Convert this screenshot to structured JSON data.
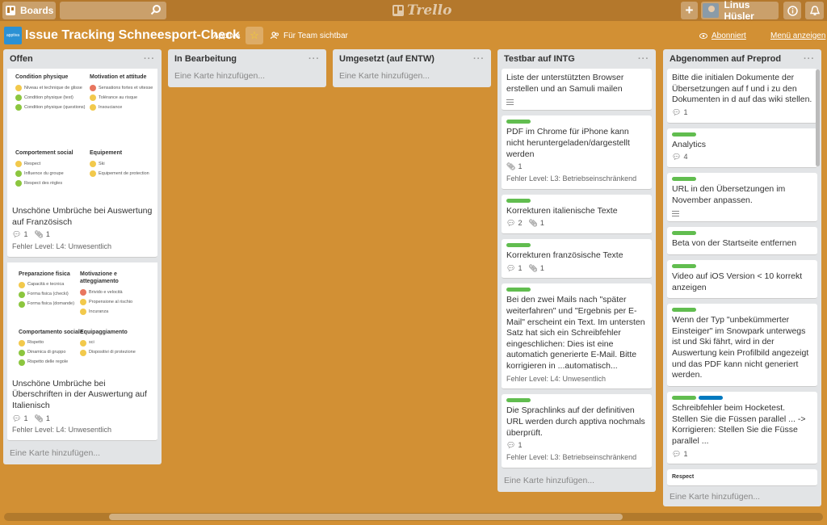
{
  "header": {
    "boards_label": "Boards",
    "logo_text": "Trello",
    "plus_label": "+",
    "user_name": "Linus Hüsler"
  },
  "board": {
    "title": "Issue Tracking Schneesport-Check",
    "org": "Apptiva",
    "visibility": "Für Team sichtbar",
    "subscribed": "Abonniert",
    "menu": "Menü anzeigen",
    "logo_text": "apptiva"
  },
  "cover_fr": {
    "col1_title": "Condition physique",
    "col1_items": [
      "Niveau et technique de glisse",
      "Condition physique (test)",
      "Condition physique (questions)"
    ],
    "col2_title": "Motivation et attitude",
    "col2_items": [
      "Sensations fortes et vitesse",
      "Tolérance au risque",
      "Insouciance"
    ],
    "col3_title": "Comportement social",
    "col3_items": [
      "Respect",
      "Influence du groupe",
      "Respect des règles"
    ],
    "col4_title": "Equipement",
    "col4_items": [
      "Ski",
      "Equipement de protection"
    ]
  },
  "cover_it": {
    "col1_title": "Preparazione fisica",
    "col1_items": [
      "Capacità e tecnica",
      "Forma fisica (checki)",
      "Forma fisica (domande)"
    ],
    "col2_title": "Motivazione e atteggiamento",
    "col2_items": [
      "Brivido e velocità",
      "Propensione al rischio",
      "Incuranza"
    ],
    "col3_title": "Comportamento sociale",
    "col3_items": [
      "Rispetto",
      "Dinamica di gruppo",
      "Rispetto delle regole"
    ],
    "col4_title": "Equipaggiamento",
    "col4_items": [
      "sci",
      "Dispositivi di protezione"
    ]
  },
  "lists": [
    {
      "title": "Offen",
      "add": "Eine Karte hinzufügen...",
      "cards": [
        {
          "title": "Unschöne Umbrüche bei Auswertung auf Französisch",
          "comments": "1",
          "attachments": "1",
          "custom": "Fehler Level: L4: Unwesentlich"
        },
        {
          "title": "Unschöne Umbrüche bei Überschriften in der Auswertung auf Italienisch",
          "comments": "1",
          "attachments": "1",
          "custom": "Fehler Level: L4: Unwesentlich"
        }
      ]
    },
    {
      "title": "In Bearbeitung",
      "add": "Eine Karte hinzufügen..."
    },
    {
      "title": "Umgesetzt (auf ENTW)",
      "add": "Eine Karte hinzufügen..."
    },
    {
      "title": "Testbar auf INTG",
      "add": "Eine Karte hinzufügen...",
      "cards": [
        {
          "title": "Liste der unterstützten Browser erstellen und an Samuli mailen"
        },
        {
          "title": "PDF im Chrome für iPhone kann nicht heruntergeladen/dargestellt werden",
          "attachments": "1",
          "custom": "Fehler Level: L3: Betriebseinschränkend"
        },
        {
          "title": "Korrekturen italienische Texte",
          "comments": "2",
          "attachments": "1"
        },
        {
          "title": "Korrekturen französische Texte",
          "comments": "1",
          "attachments": "1"
        },
        {
          "title": "Bei den zwei Mails nach \"später weiterfahren\" und \"Ergebnis per E-Mail\" erscheint ein Text. Im untersten Satz hat sich ein Schreibfehler eingeschlichen: Dies ist eine automatich generierte E-Mail. Bitte korrigieren in ...automatisch...",
          "custom": "Fehler Level: L4: Unwesentlich"
        },
        {
          "title": "Die Sprachlinks auf der definitiven URL werden durch apptiva nochmals überprüft.",
          "comments": "1",
          "custom": "Fehler Level: L3: Betriebseinschränkend"
        }
      ]
    },
    {
      "title": "Abgenommen auf Preprod",
      "add": "Eine Karte hinzufügen...",
      "cards": [
        {
          "title": "Bitte die initialen Dokumente der Übersetzungen auf f und i zu den Dokumenten in d auf das wiki stellen.",
          "comments": "1"
        },
        {
          "title": "Analytics",
          "comments": "4"
        },
        {
          "title": "URL in den Übersetzungen im November anpassen."
        },
        {
          "title": "Beta von der Startseite entfernen"
        },
        {
          "title": "Video auf iOS Version < 10 korrekt anzeigen"
        },
        {
          "title": "Wenn der Typ \"unbekümmerter Einsteiger\" im Snowpark unterwegs ist und Ski fährt, wird in der Auswertung kein Profilbild angezeigt und das PDF kann nicht generiert werden."
        },
        {
          "title": "Schreibfehler beim Hocketest. Stellen Sie die Füssen parallel ... -> Korrigieren: Stellen Sie die Füsse parallel ...",
          "comments": "1"
        },
        {
          "title": "Respect"
        }
      ]
    }
  ],
  "list_menu": "···",
  "colors": {
    "background": "#d29034",
    "label_green": "#61bd4f",
    "label_blue": "#0079bf"
  }
}
